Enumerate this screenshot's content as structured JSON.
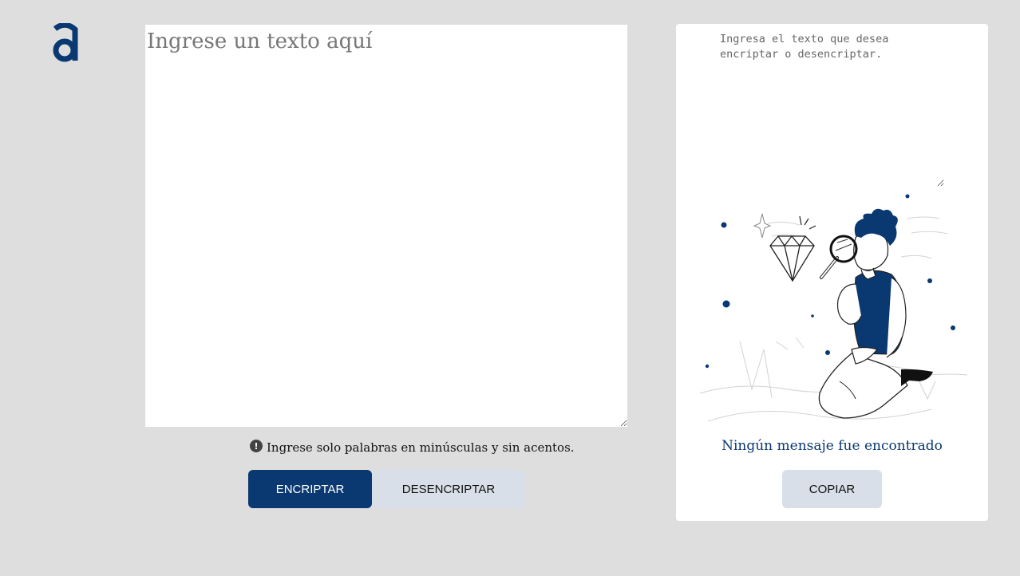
{
  "logo": {
    "letter": "a",
    "color": "#0a3871"
  },
  "input": {
    "placeholder": "Ingrese un texto aquí",
    "value": ""
  },
  "hint": {
    "icon": "exclamation-circle-icon",
    "text": "Ingrese solo palabras en minúsculas y sin acentos."
  },
  "buttons": {
    "encrypt": "ENCRIPTAR",
    "decrypt": "DESENCRIPTAR",
    "copy": "COPIAR"
  },
  "output": {
    "placeholder": "Ingresa el texto que desea encriptar o desencriptar.",
    "value": ""
  },
  "empty_state": {
    "illustration": "person-with-magnifier-illustration",
    "message": "Ningún mensaje fue encontrado"
  },
  "colors": {
    "background": "#dedede",
    "primary": "#0a3871",
    "secondary_button": "#d8dfe8",
    "panel": "#ffffff"
  }
}
